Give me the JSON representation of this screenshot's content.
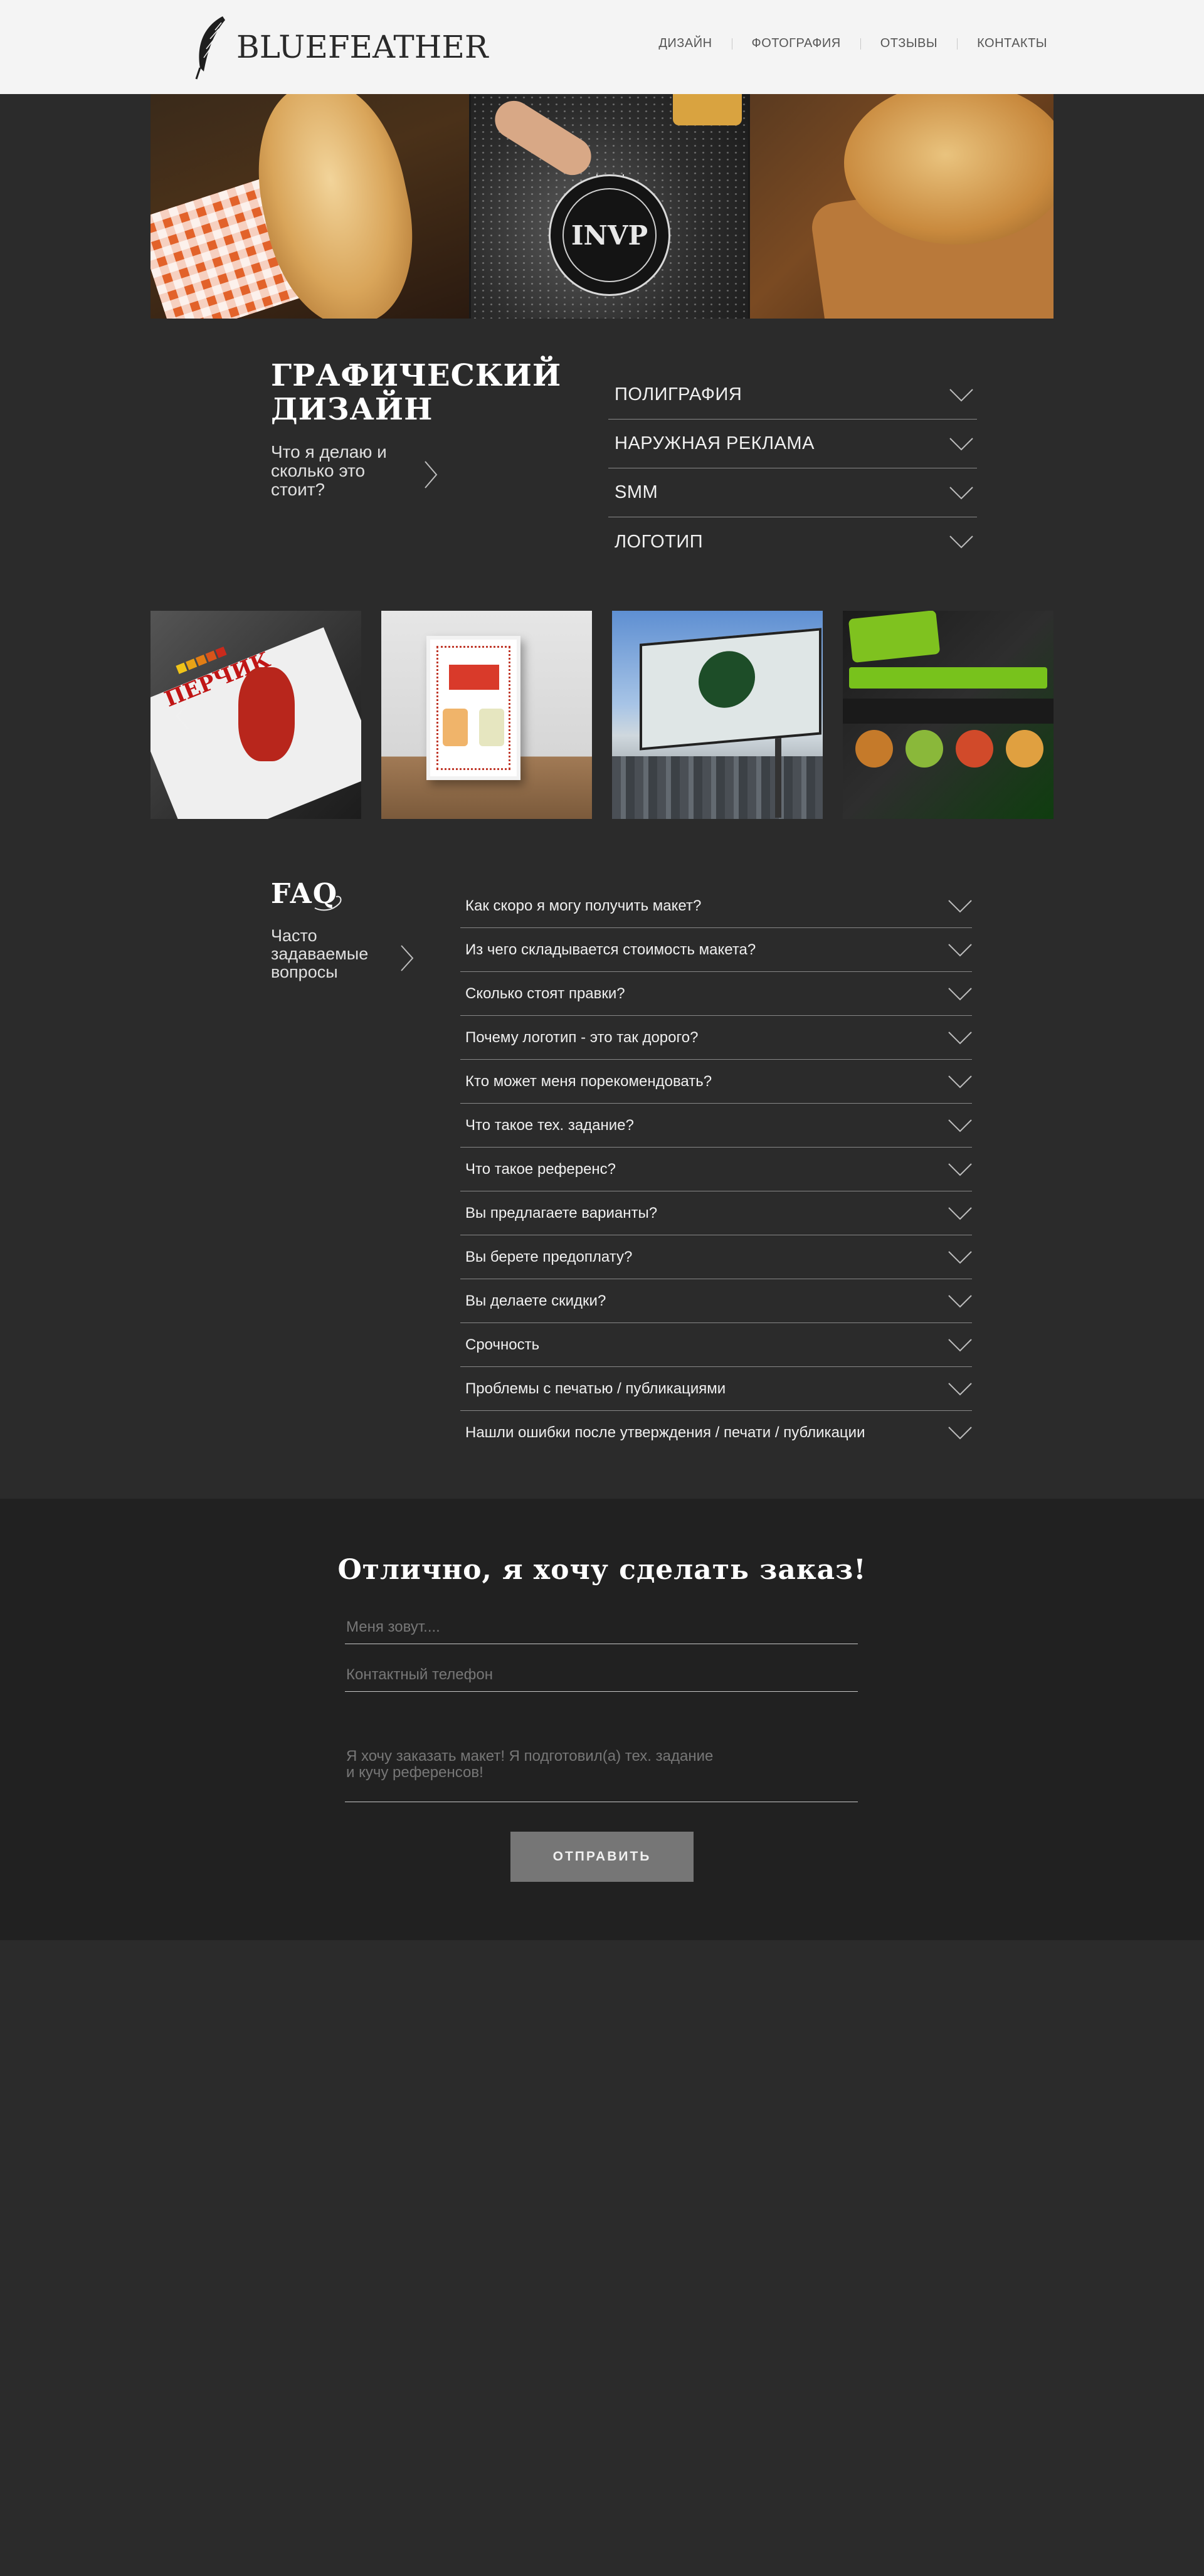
{
  "header": {
    "logo_text": "BLUEFEATHER",
    "nav": [
      {
        "label": "ДИЗАЙН"
      },
      {
        "label": "ФОТОГРАФИЯ"
      },
      {
        "label": "ОТЗЫВЫ"
      },
      {
        "label": "КОНТАКТЫ"
      }
    ]
  },
  "hero": {
    "emblem_letters": "INVP"
  },
  "design": {
    "title": "ГРАФИЧЕСКИЙ ДИЗАЙН",
    "subtitle": "Что я делаю и сколько это стоит?",
    "services": [
      {
        "label": "ПОЛИГРАФИЯ"
      },
      {
        "label": "НАРУЖНАЯ РЕКЛАМА"
      },
      {
        "label": "SMM"
      },
      {
        "label": "ЛОГОТИП"
      }
    ]
  },
  "gallery": {
    "item1_text": "ПЕРЧИК"
  },
  "faq": {
    "title": "FAQ",
    "subtitle": "Часто задаваемые вопросы",
    "items": [
      {
        "question": "Как скоро я могу получить макет?"
      },
      {
        "question": "Из чего складывается стоимость макета?"
      },
      {
        "question": "Сколько стоят правки?"
      },
      {
        "question": "Почему логотип - это так дорого?"
      },
      {
        "question": "Кто может меня порекомендовать?"
      },
      {
        "question": "Что такое тех. задание?"
      },
      {
        "question": "Что такое референс?"
      },
      {
        "question": "Вы предлагаете варианты?"
      },
      {
        "question": "Вы берете предоплату?"
      },
      {
        "question": "Вы делаете скидки?"
      },
      {
        "question": "Срочность"
      },
      {
        "question": "Проблемы с печатью / публикациями"
      },
      {
        "question": "Нашли ошибки после утверждения / печати / публикации"
      }
    ]
  },
  "order": {
    "title": "Отлично, я хочу сделать заказ!",
    "name_placeholder": "Меня зовут....",
    "phone_placeholder": "Контактный телефон",
    "message_placeholder": "Я хочу заказать макет! Я подготовил(а) тех. задание\nи кучу референсов!",
    "submit_label": "ОТПРАВИТЬ"
  },
  "colors": {
    "page_bg": "#2b2b2b",
    "header_bg": "#f4f4f4",
    "order_bg": "#212121",
    "button_bg": "#767676"
  }
}
